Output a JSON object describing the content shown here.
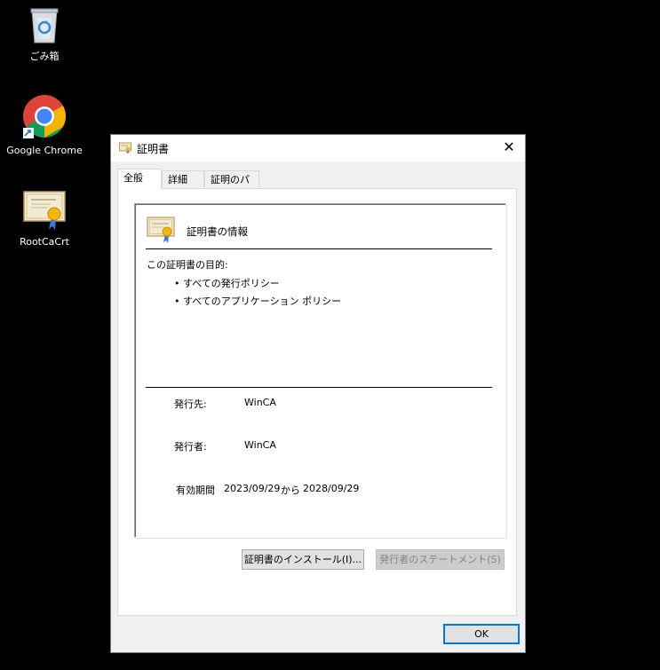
{
  "desktop": {
    "icons": [
      {
        "label": "ごみ箱"
      },
      {
        "label": "Google Chrome"
      },
      {
        "label": "RootCaCrt"
      }
    ]
  },
  "dialog": {
    "title": "証明書",
    "tabs": [
      {
        "label": "全般",
        "active": true
      },
      {
        "label": "詳細",
        "active": false
      },
      {
        "label": "証明のパス",
        "active": false
      }
    ],
    "info_title": "証明書の情報",
    "purpose_label": "この証明書の目的:",
    "purposes": [
      "すべての発行ポリシー",
      "すべてのアプリケーション ポリシー"
    ],
    "issued_to_label": "発行先:",
    "issued_to_value": "WinCA",
    "issued_by_label": "発行者:",
    "issued_by_value": "WinCA",
    "validity_label": "有効期間",
    "valid_from": "2023/09/29",
    "from_word": "から",
    "valid_to": "2028/09/29",
    "install_button": "証明書のインストール(I)...",
    "statement_button": "発行者のステートメント(S)",
    "ok_button": "OK"
  }
}
